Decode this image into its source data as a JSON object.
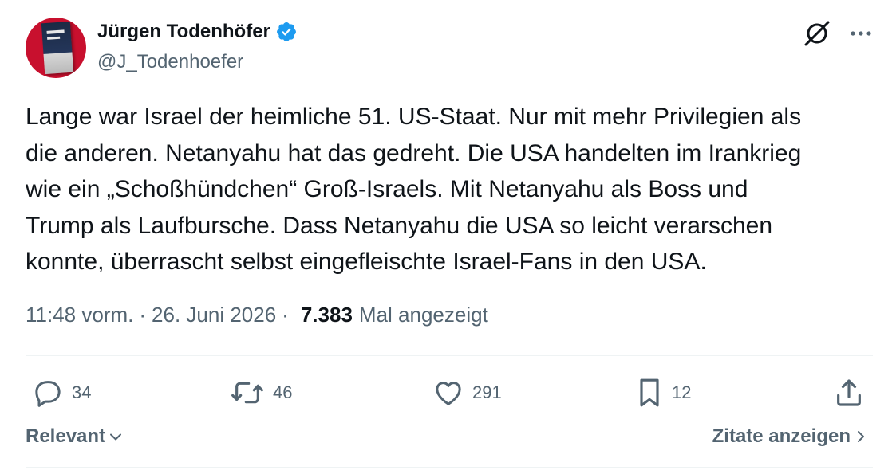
{
  "author": {
    "name": "Jürgen Todenhöfer",
    "handle": "@J_Todenhoefer",
    "verified_icon": "verified-badge-icon",
    "accent_color": "#1d9bf0"
  },
  "header_icons": [
    "grok-icon",
    "more-icon"
  ],
  "tweet": {
    "text": "Lange war Israel der heimliche 51. US-Staat. Nur mit mehr Privilegien als\ndie anderen. Netanyahu hat das gedreht. Die USA handelten im Irankrieg\nwie ein „Schoßhündchen“ Groß-Israels. Mit Netanyahu als Boss und\nTrump als Laufbursche. Dass Netanyahu die USA so leicht verarschen\nkonnte, überrascht selbst eingefleischte Israel-Fans in den USA."
  },
  "meta": {
    "time": "11:48 vorm.",
    "date": "26. Juni 2026",
    "views_count": "7.383",
    "views_label": "Mal angezeigt",
    "separator": "·"
  },
  "actions": {
    "replies": "34",
    "reposts": "46",
    "likes": "291",
    "bookmarks": "12"
  },
  "footer": {
    "sort_label": "Relevant",
    "quotes_label": "Zitate anzeigen"
  }
}
